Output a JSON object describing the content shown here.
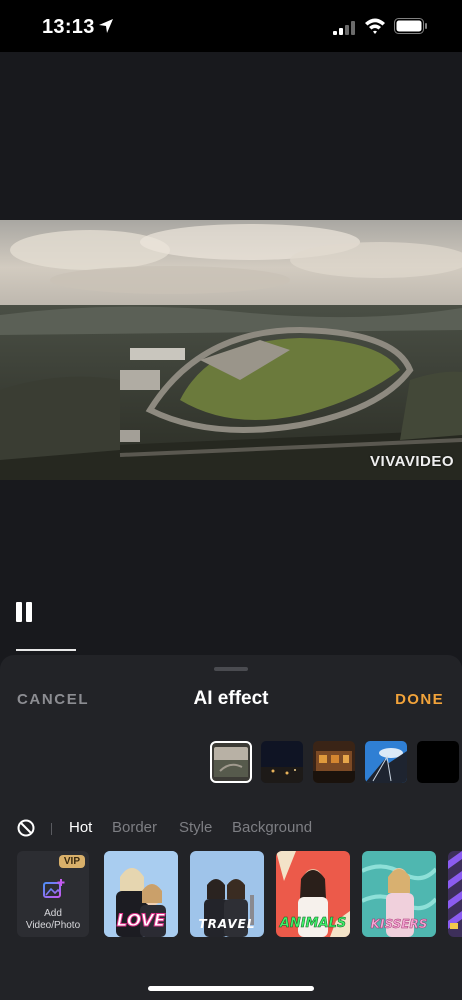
{
  "status_bar": {
    "time": "13:13"
  },
  "video": {
    "watermark": "VIVAVIDEO"
  },
  "panel": {
    "cancel_label": "CANCEL",
    "title": "AI effect",
    "done_label": "DONE"
  },
  "tabs": [
    "Hot",
    "Border",
    "Style",
    "Background"
  ],
  "active_tab": "Hot",
  "add_tile": {
    "badge": "VIP",
    "label_line1": "Add",
    "label_line2": "Video/Photo"
  },
  "effects": [
    {
      "label": "LOVE"
    },
    {
      "label": "TRAVEL"
    },
    {
      "label": "ANIMALS"
    },
    {
      "label": "KISSERS"
    }
  ],
  "colors": {
    "accent": "#f2a33a",
    "panel": "#222327",
    "background": "#18191d"
  }
}
